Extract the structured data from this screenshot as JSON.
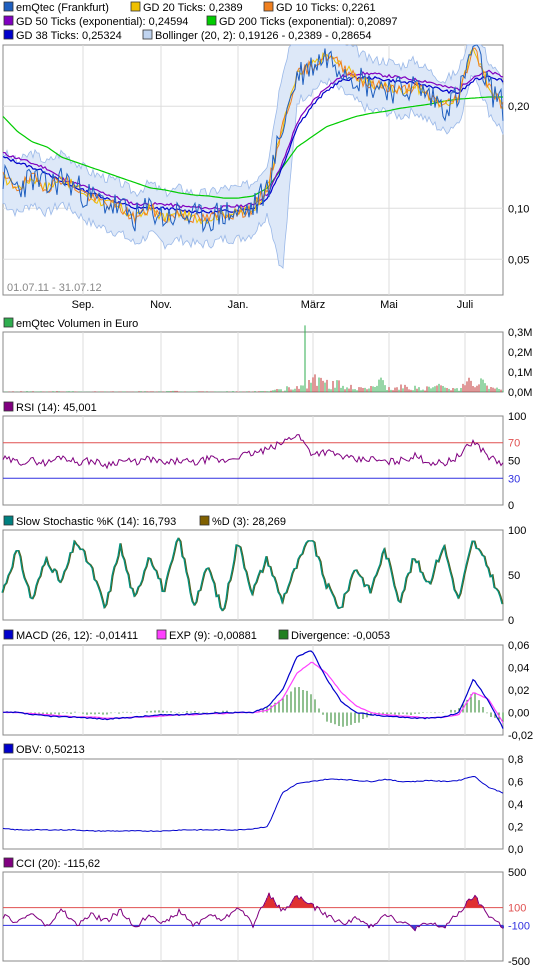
{
  "chart_data": [
    {
      "type": "line",
      "title": "emQtec (Frankfurt)",
      "date_range": "01.07.11 - 31.07.12",
      "x_ticks": [
        "Sep.",
        "Nov.",
        "Jan.",
        "März",
        "Mai",
        "Juli"
      ],
      "y_ticks": [
        "0,20",
        "0,10",
        "0,05"
      ],
      "series": [
        {
          "name": "emQtec (Frankfurt)",
          "color": "#1f5fbf"
        },
        {
          "name": "GD 20 Ticks: 0,2389",
          "color": "#f0c000"
        },
        {
          "name": "GD 10 Ticks: 0,2261",
          "color": "#f08020"
        },
        {
          "name": "GD 50 Ticks (exponential): 0,24594",
          "color": "#8000c0"
        },
        {
          "name": "GD 200 Ticks (exponential): 0,20897",
          "color": "#00cc00"
        },
        {
          "name": "GD 38 Ticks: 0,25324",
          "color": "#0000cc"
        },
        {
          "name": "Bollinger (20, 2): 0,19126 - 0,2389 - 0,28654",
          "color": "#9ab8e8"
        }
      ],
      "price": [
        0.13,
        0.12,
        0.13,
        0.12,
        0.13,
        0.12,
        0.11,
        0.105,
        0.1,
        0.09,
        0.1,
        0.09,
        0.095,
        0.09,
        0.09,
        0.095,
        0.095,
        0.1,
        0.12,
        0.18,
        0.23,
        0.24,
        0.25,
        0.24,
        0.23,
        0.22,
        0.22,
        0.215,
        0.22,
        0.21,
        0.2,
        0.21,
        0.26,
        0.22,
        0.2
      ],
      "gd200": [
        0.19,
        0.175,
        0.165,
        0.16,
        0.15,
        0.145,
        0.14,
        0.135,
        0.13,
        0.125,
        0.12,
        0.118,
        0.115,
        0.113,
        0.112,
        0.11,
        0.11,
        0.112,
        0.12,
        0.14,
        0.16,
        0.17,
        0.18,
        0.185,
        0.19,
        0.193,
        0.195,
        0.198,
        0.2,
        0.202,
        0.205,
        0.207,
        0.208,
        0.209,
        0.209
      ],
      "gd38": [
        0.15,
        0.145,
        0.14,
        0.135,
        0.125,
        0.12,
        0.115,
        0.11,
        0.105,
        0.1,
        0.1,
        0.1,
        0.098,
        0.097,
        0.096,
        0.097,
        0.098,
        0.1,
        0.11,
        0.14,
        0.18,
        0.2,
        0.215,
        0.225,
        0.228,
        0.228,
        0.226,
        0.224,
        0.222,
        0.22,
        0.215,
        0.213,
        0.225,
        0.23,
        0.225
      ],
      "ylim": [
        0.015,
        0.26
      ]
    },
    {
      "type": "bar",
      "title": "emQtec Volumen in Euro",
      "y_ticks": [
        "0,3M",
        "0,2M",
        "0,1M",
        "0,0M"
      ],
      "ylim": [
        0,
        0.3
      ],
      "values": [
        0.002,
        0.003,
        0.002,
        0.004,
        0.003,
        0.002,
        0.003,
        0.002,
        0.002,
        0.003,
        0.002,
        0.004,
        0.002,
        0.003,
        0.002,
        0.003,
        0.002,
        0.004,
        0.01,
        0.02,
        0.27,
        0.06,
        0.04,
        0.03,
        0.02,
        0.05,
        0.02,
        0.03,
        0.02,
        0.03,
        0.02,
        0.06,
        0.05,
        0.02,
        0.01
      ]
    },
    {
      "type": "line",
      "title": "RSI (14): 45,001",
      "y_ticks": [
        "100",
        "70",
        "50",
        "30",
        "0"
      ],
      "ylim": [
        0,
        100
      ],
      "reference_lines": [
        70,
        30
      ],
      "values": [
        52,
        48,
        50,
        47,
        55,
        48,
        50,
        45,
        50,
        48,
        52,
        46,
        50,
        47,
        52,
        49,
        55,
        58,
        62,
        70,
        80,
        58,
        60,
        55,
        50,
        52,
        48,
        50,
        55,
        48,
        47,
        55,
        72,
        55,
        45
      ]
    },
    {
      "type": "line",
      "title": "Slow Stochastic %K (14): 16,793",
      "series_labels": [
        "Slow Stochastic %K (14): 16,793",
        "%D (3): 28,269"
      ],
      "y_ticks": [
        "100",
        "50",
        "0"
      ],
      "ylim": [
        0,
        100
      ],
      "values": [
        30,
        80,
        20,
        70,
        40,
        90,
        60,
        10,
        85,
        20,
        75,
        30,
        95,
        15,
        60,
        5,
        90,
        30,
        70,
        20,
        60,
        95,
        40,
        10,
        60,
        30,
        80,
        20,
        70,
        40,
        85,
        20,
        90,
        60,
        17
      ]
    },
    {
      "type": "line",
      "title": "MACD (26, 12): -0,01411",
      "series_labels": [
        "MACD (26, 12): -0,01411",
        "EXP (9): -0,00881",
        "Divergence: -0,0053"
      ],
      "y_ticks": [
        "0,06",
        "0,04",
        "0,02",
        "0,00",
        "-0,02"
      ],
      "ylim": [
        -0.02,
        0.06
      ],
      "macd": [
        0.0,
        0.0,
        -0.002,
        -0.003,
        -0.004,
        -0.004,
        -0.005,
        -0.006,
        -0.005,
        -0.004,
        -0.003,
        -0.002,
        -0.002,
        -0.001,
        -0.001,
        0.0,
        0.0,
        0.0,
        0.005,
        0.02,
        0.05,
        0.055,
        0.03,
        0.01,
        0.0,
        -0.002,
        -0.003,
        -0.004,
        -0.005,
        -0.005,
        -0.004,
        0.0,
        0.03,
        0.01,
        -0.014
      ],
      "exp": [
        0.0,
        0.0,
        -0.001,
        -0.002,
        -0.003,
        -0.004,
        -0.004,
        -0.005,
        -0.005,
        -0.004,
        -0.004,
        -0.003,
        -0.002,
        -0.002,
        -0.001,
        -0.001,
        0.0,
        0.0,
        0.002,
        0.012,
        0.035,
        0.045,
        0.035,
        0.018,
        0.006,
        0.0,
        -0.002,
        -0.003,
        -0.004,
        -0.005,
        -0.004,
        -0.002,
        0.018,
        0.012,
        -0.009
      ]
    },
    {
      "type": "line",
      "title": "OBV: 0,50213",
      "y_ticks": [
        "0,8",
        "0,6",
        "0,4",
        "0,2",
        "0,0"
      ],
      "ylim": [
        0,
        0.8
      ],
      "values": [
        0.18,
        0.17,
        0.17,
        0.17,
        0.17,
        0.17,
        0.16,
        0.16,
        0.16,
        0.16,
        0.16,
        0.16,
        0.17,
        0.17,
        0.17,
        0.17,
        0.17,
        0.18,
        0.2,
        0.5,
        0.58,
        0.6,
        0.62,
        0.62,
        0.61,
        0.6,
        0.62,
        0.6,
        0.6,
        0.61,
        0.6,
        0.61,
        0.65,
        0.55,
        0.5
      ]
    },
    {
      "type": "line",
      "title": "CCI (20): -115,62",
      "y_ticks": [
        "500",
        "100",
        "-100",
        "-500"
      ],
      "ylim": [
        -500,
        500
      ],
      "reference_lines": [
        100,
        -100
      ],
      "values": [
        0,
        -60,
        40,
        -120,
        80,
        -100,
        20,
        -50,
        60,
        -120,
        30,
        -80,
        60,
        -100,
        20,
        -40,
        120,
        -100,
        250,
        60,
        230,
        120,
        20,
        -80,
        -20,
        -120,
        40,
        -60,
        -130,
        -80,
        -120,
        40,
        230,
        20,
        -116
      ]
    }
  ]
}
